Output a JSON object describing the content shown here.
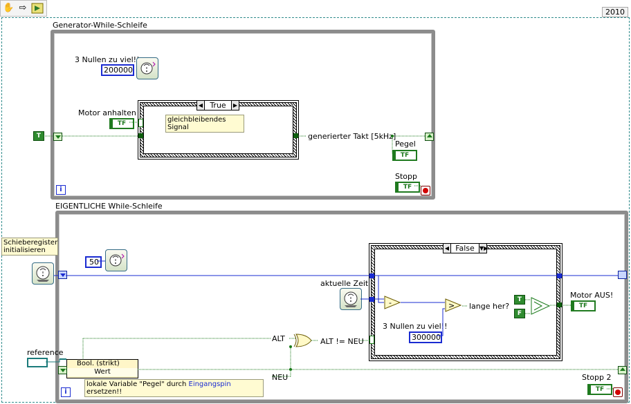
{
  "toolbar": {
    "icons": [
      "hand-icon",
      "arrow-icon",
      "run-icon"
    ]
  },
  "version": "2010",
  "loop1": {
    "title": "Generator-While-Schleife",
    "num_label": "3 Nullen zu viel!!",
    "num_value": "200000",
    "motor_label": "Motor anhalten",
    "motor_term": "TF",
    "case_selector": "True",
    "case_note": "gleichbleibendes Signal",
    "takt_label": "generierter Takt [5kHz]",
    "pegel_label": "Pegel",
    "pegel_term": "TF",
    "stop_label": "Stopp",
    "stop_term": "TF",
    "iter": "i",
    "true_const": "T"
  },
  "loop2": {
    "title": "EIGENTLICHE While-Schleife",
    "shift_note": "Schieberegister initialisieren",
    "num_50": "50",
    "case_selector": "False",
    "aktuelle_label": "aktuelle Zeit",
    "lange_label": "lange her?",
    "num_label": "3 Nullen zu viel!!",
    "num_value": "300000",
    "t_const": "T",
    "f_const": "F",
    "motor_aus_label": "Motor AUS!",
    "motor_aus_term": "TF",
    "alt_label": "ALT",
    "alt_neu_label": "ALT != NEU",
    "neu_label": "NEU",
    "reference_label": "reference",
    "bundle_row1": "Bool. (strikt)",
    "bundle_row2": "Wert",
    "local_note_pre": "lokale Variable \"Pegel\" durch ",
    "local_note_link": "Eingangspin",
    "local_note_post": " ersetzen!!",
    "stop_label": "Stopp 2",
    "stop_term": "TF",
    "iter": "i"
  },
  "colors": {
    "boolean_wire": "#1a7a1a",
    "numeric_wire": "#1a2bd1",
    "loop_border": "#8c8c8c"
  }
}
